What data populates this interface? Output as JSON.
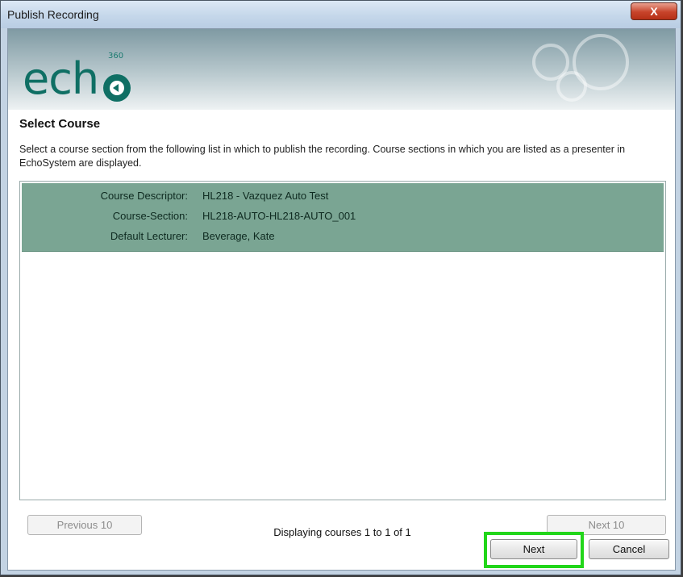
{
  "window": {
    "title": "Publish Recording",
    "close_label": "X"
  },
  "banner": {
    "logo_text": "ech",
    "logo_superscript": "360"
  },
  "section": {
    "heading": "Select Course",
    "description": "Select a course section from the following list in which to publish the recording. Course sections in which you are listed as a presenter in EchoSystem are displayed."
  },
  "course_list": [
    {
      "fields": [
        {
          "label": "Course Descriptor:",
          "value": "HL218 - Vazquez Auto Test"
        },
        {
          "label": "Course-Section:",
          "value": "HL218-AUTO-HL218-AUTO_001"
        },
        {
          "label": "Default Lecturer:",
          "value": "Beverage, Kate"
        }
      ]
    }
  ],
  "pagination": {
    "previous_label": "Previous 10",
    "status_text": "Displaying courses 1 to 1 of 1",
    "next_page_label": "Next 10"
  },
  "actions": {
    "next_label": "Next",
    "cancel_label": "Cancel"
  },
  "colors": {
    "selected_row": "#7aa593",
    "highlight": "#22d61a",
    "logo": "#0f6f64"
  }
}
